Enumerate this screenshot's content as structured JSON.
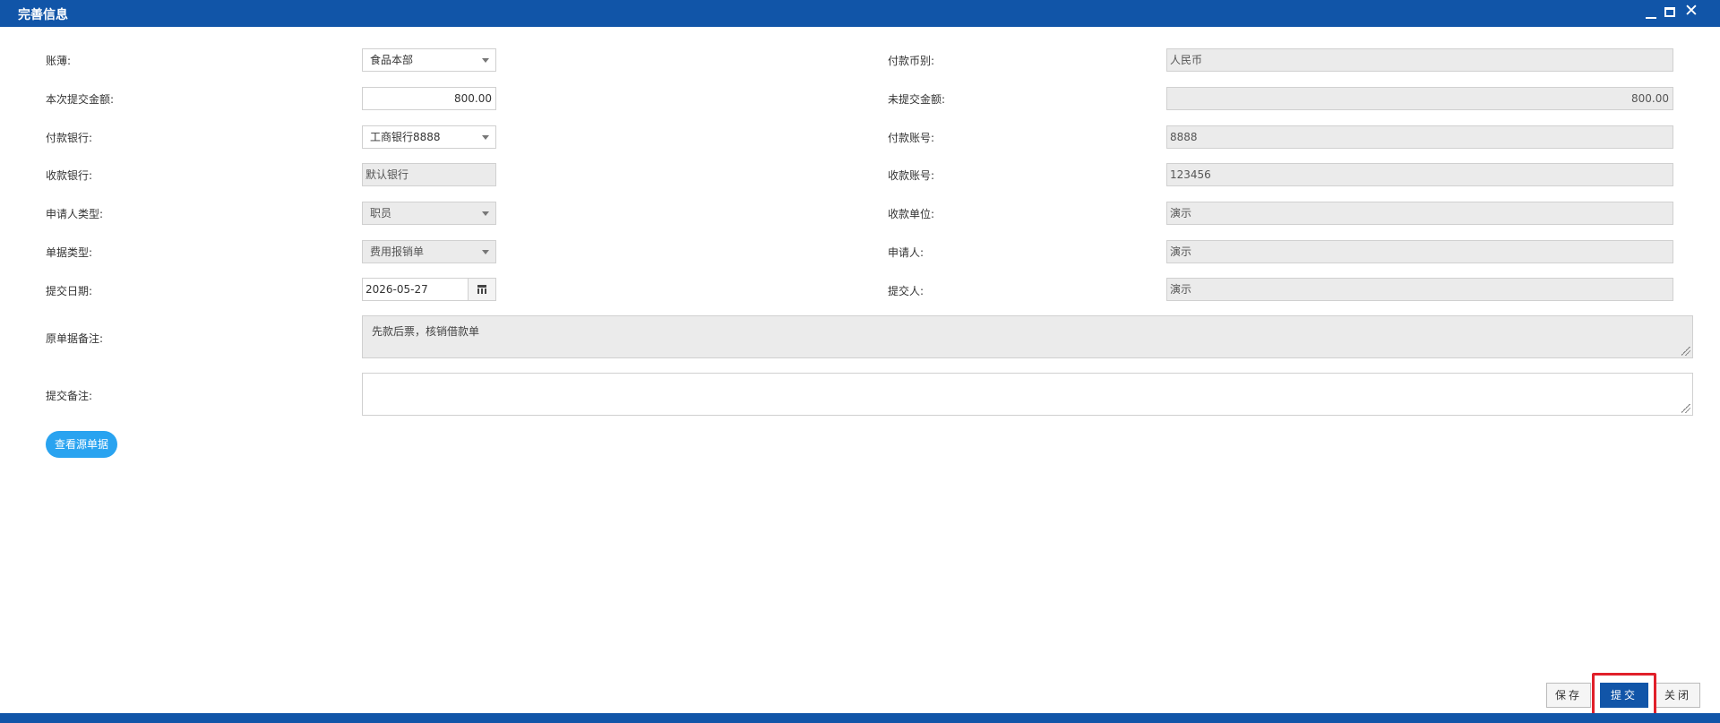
{
  "window": {
    "title": "完善信息",
    "controls": [
      "minimize-icon",
      "maximize-icon",
      "close-icon"
    ]
  },
  "form": {
    "ledger": {
      "label": "账薄:",
      "value": "食品本部"
    },
    "currency": {
      "label": "付款币别:",
      "value": "人民币"
    },
    "submit_amount": {
      "label": "本次提交金额:",
      "value": "800.00"
    },
    "unsubmitted_amount": {
      "label": "未提交金额:",
      "value": "800.00"
    },
    "pay_bank": {
      "label": "付款银行:",
      "value": "工商银行8888"
    },
    "pay_account": {
      "label": "付款账号:",
      "value": "8888"
    },
    "receive_bank": {
      "label": "收款银行:",
      "value": "默认银行"
    },
    "receive_account": {
      "label": "收款账号:",
      "value": "123456"
    },
    "applicant_type": {
      "label": "申请人类型:",
      "value": "职员"
    },
    "payee_unit": {
      "label": "收款单位:",
      "value": "演示"
    },
    "doc_type": {
      "label": "单据类型:",
      "value": "费用报销单"
    },
    "applicant": {
      "label": "申请人:",
      "value": "演示"
    },
    "submit_date": {
      "label": "提交日期:",
      "value": "2026-05-27"
    },
    "submitter": {
      "label": "提交人:",
      "value": "演示"
    },
    "original_remark": {
      "label": "原单据备注:",
      "value": "先款后票，核销借款单"
    },
    "submit_remark": {
      "label": "提交备注:",
      "value": ""
    }
  },
  "view_source_button": "查看源单据",
  "footer": {
    "save": "保存",
    "submit": "提交",
    "close": "关闭"
  },
  "colors": {
    "brand": "#1155a8",
    "link_button": "#29a3f0",
    "readonly_bg": "#ebebeb",
    "highlight": "#e0202a"
  }
}
